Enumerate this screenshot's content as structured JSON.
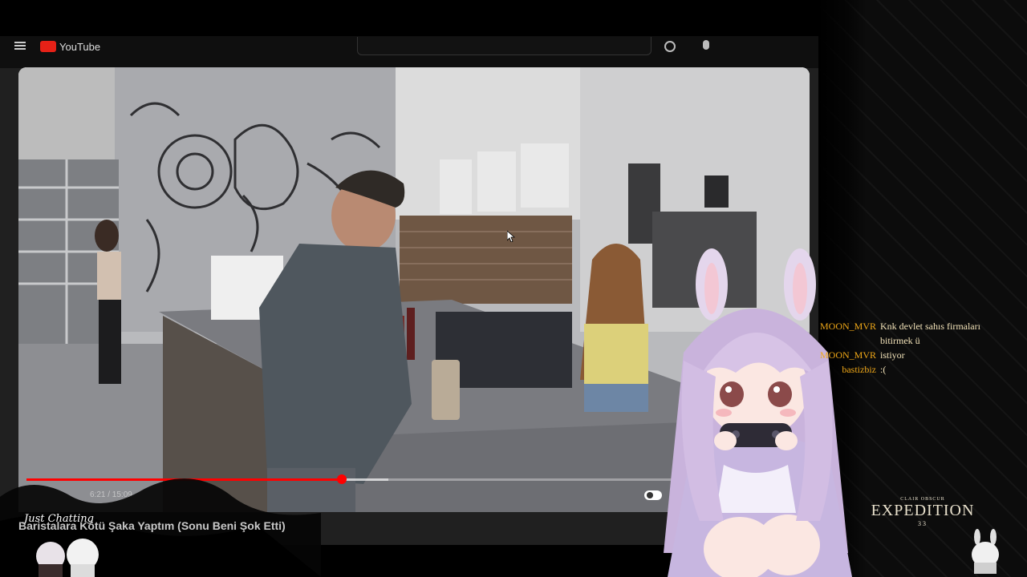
{
  "youtube": {
    "logo_text": "YouTube",
    "video_time": "6:21 / 15:09",
    "progress_fraction": 0.405,
    "buffer_fraction": 0.465,
    "video_title": "Baristalara Kötü Şaka Yaptım (Sonu Beni Şok Etti)"
  },
  "stream": {
    "category": "Just Chatting"
  },
  "chat": [
    {
      "user": "MOON_MVR",
      "message": "Knk devlet sahıs firmaları bitirmek ü"
    },
    {
      "user": "MOON_MVR",
      "message": "istiyor"
    },
    {
      "user": "bastizbiz",
      "message": ":("
    }
  ],
  "game_logo": {
    "small": "CLAIR OBSCUR",
    "main": "EXPEDITION",
    "sub": "33"
  },
  "colors": {
    "chat_user": "#f0a818",
    "chat_message": "#f2e2b8",
    "progress": "#ff0000"
  }
}
